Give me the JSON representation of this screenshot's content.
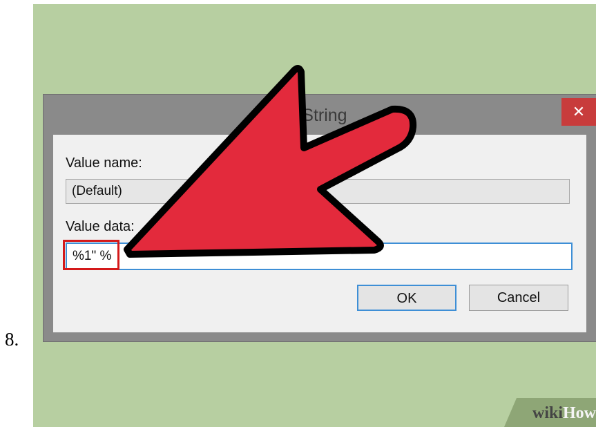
{
  "step_number": "8.",
  "dialog": {
    "title": "t String",
    "close_glyph": "✕",
    "value_name_label": "Value name:",
    "value_name": "(Default)",
    "value_data_label": "Value data:",
    "value_data": "%1\" %",
    "ok_label": "OK",
    "cancel_label": "Cancel"
  },
  "watermark": {
    "part1": "wiki",
    "part2": "How"
  },
  "colors": {
    "background": "#b7cfa1",
    "arrow_fill": "#e32a3c",
    "highlight": "#d4191a",
    "close_button": "#c83c3c",
    "focus_border": "#3e8fd6"
  },
  "icons": {
    "close": "close-icon",
    "arrow": "pointer-arrow-icon"
  }
}
